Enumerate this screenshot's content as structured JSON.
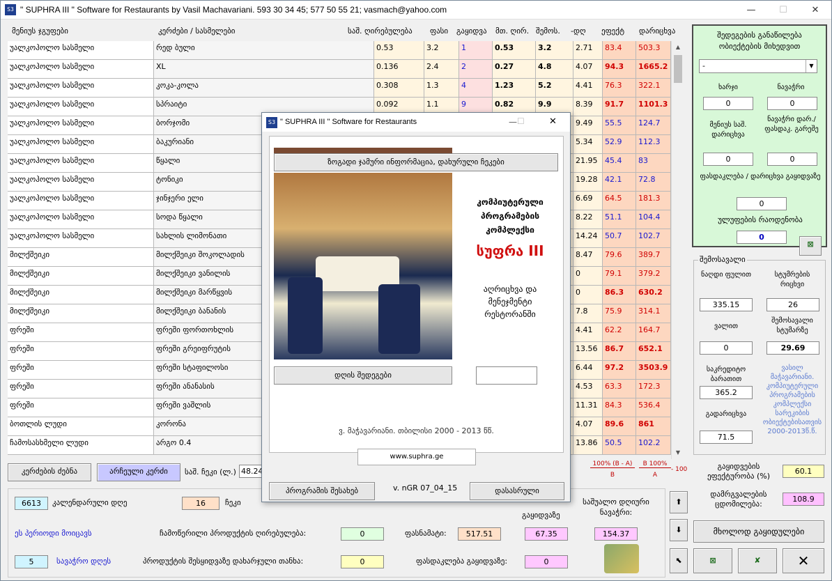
{
  "window": {
    "title": "\" SUPHRA III \" Software for Restaurants by Vasil Machavariani. 593 30 34 45; 577 50 55 21; vasmach@yahoo.com",
    "minimize": "—",
    "maximize": "☐",
    "close": "✕"
  },
  "headers": {
    "group": "მენიუს ჯგუფები",
    "dish": "კერძები / სასმელები",
    "cost": "საშ. ღირებულება",
    "price": "ფასი",
    "sold": "გაყიდვა",
    "perunit": "მთ. ღირ.",
    "income": "შემოს.",
    "diff": "-დღ",
    "eff": "ეფექტ",
    "perc": "დარიცხვა"
  },
  "rows": [
    [
      "უალკოჰოლო სასმელი",
      "რედ ბული",
      "0.53",
      "3.2",
      "1",
      "0.53",
      "3.2",
      "2.71",
      "83.4",
      "503.3",
      0,
      0
    ],
    [
      "უალკოჰოლო სასმელი",
      "XL",
      "0.136",
      "2.4",
      "2",
      "0.27",
      "4.8",
      "4.07",
      "94.3",
      "1665.2",
      1,
      1
    ],
    [
      "უალკოჰოლო სასმელი",
      "კოკა-კოლა",
      "0.308",
      "1.3",
      "4",
      "1.23",
      "5.2",
      "4.41",
      "76.3",
      "322.1",
      0,
      0
    ],
    [
      "უალკოჰოლო სასმელი",
      "სპრაიტი",
      "0.092",
      "1.1",
      "9",
      "0.82",
      "9.9",
      "8.39",
      "91.7",
      "1101.3",
      1,
      1
    ],
    [
      "უალკოჰოლო სასმელი",
      "ბორჯომი",
      "",
      "",
      "",
      "",
      "",
      "9.49",
      "55.5",
      "124.7",
      2,
      2
    ],
    [
      "უალკოჰოლო სასმელი",
      "ბაკურიანი",
      "",
      "",
      "",
      "",
      "",
      "5.34",
      "52.9",
      "112.3",
      2,
      2
    ],
    [
      "უალკოჰოლო სასმელი",
      "წყალი",
      "",
      "",
      "",
      "",
      "",
      "21.95",
      "45.4",
      "83",
      2,
      2
    ],
    [
      "უალკოჰოლო სასმელი",
      "ტონიკი",
      "",
      "",
      "",
      "",
      "",
      "19.28",
      "42.1",
      "72.8",
      2,
      2
    ],
    [
      "უალკოჰოლო სასმელი",
      "ჯინჯერი ელი",
      "",
      "",
      "",
      "",
      "",
      "6.69",
      "64.5",
      "181.3",
      0,
      0
    ],
    [
      "უალკოჰოლო სასმელი",
      "სოდა წყალი",
      "",
      "",
      "",
      "",
      "",
      "8.22",
      "51.1",
      "104.4",
      2,
      2
    ],
    [
      "უალკოჰოლო სასმელი",
      "სახლის ლიმონათი",
      "",
      "",
      "",
      "",
      "",
      "14.24",
      "50.7",
      "102.7",
      2,
      2
    ],
    [
      "მილქშეიკი",
      "მილქშეიკი შოკოლადის",
      "",
      "",
      "",
      "",
      "",
      "8.47",
      "79.6",
      "389.7",
      0,
      0
    ],
    [
      "მილქშეიკი",
      "მილქშეიკი ვანილის",
      "",
      "",
      "",
      "",
      "",
      "0",
      "79.1",
      "379.2",
      0,
      0
    ],
    [
      "მილქშეიკი",
      "მილქშეიკი მარწყვის",
      "",
      "",
      "",
      "",
      "",
      "0",
      "86.3",
      "630.2",
      1,
      1
    ],
    [
      "მილქშეიკი",
      "მილქშეიკი ბანანის",
      "",
      "",
      "",
      "",
      "",
      "7.8",
      "75.9",
      "314.1",
      0,
      0
    ],
    [
      "ფრეში",
      "ფრეში ფორთოხლის",
      "",
      "",
      "",
      "",
      "",
      "4.41",
      "62.2",
      "164.7",
      0,
      0
    ],
    [
      "ფრეში",
      "ფრეში გრეიფრუტის",
      "",
      "",
      "",
      "",
      "",
      "13.56",
      "86.7",
      "652.1",
      1,
      1
    ],
    [
      "ფრეში",
      "ფრეში სტაფილოსი",
      "",
      "",
      "",
      "",
      "",
      "6.44",
      "97.2",
      "3503.9",
      1,
      1
    ],
    [
      "ფრეში",
      "ფრეში ანანასის",
      "",
      "",
      "",
      "",
      "",
      "4.53",
      "63.3",
      "172.3",
      0,
      0
    ],
    [
      "ფრეში",
      "ფრეში ვაშლის",
      "",
      "",
      "",
      "",
      "",
      "11.31",
      "84.3",
      "536.4",
      0,
      0
    ],
    [
      "ბოთლის ლუდი",
      "კორონა",
      "",
      "",
      "",
      "",
      "",
      "4.07",
      "89.6",
      "861",
      1,
      1
    ],
    [
      "ჩამოსასხმელი ლუდი",
      "არგო 0.4",
      "",
      "",
      "",
      "",
      "",
      "13.86",
      "50.5",
      "102.2",
      2,
      2
    ]
  ],
  "right_panel": {
    "title": "შედეგების განაწილება ობიექტების მიხედვით",
    "select_value": "-",
    "expense_label": "ხარჯი",
    "expense": "0",
    "profit_label": "ნავაჭრი",
    "profit": "0",
    "menu_avg_label": "მენიუს საშ. დარიცხვა",
    "menu_avg": "0",
    "profit2_label": "ნავაჭრი დარ./ფასდაკ. გარეშე",
    "profit2": "0",
    "discount_label": "ფასდაკლება / დარიცხვა გაყიდვაზე",
    "discount": "0",
    "packs_label": "ულუფების რაოდენობა",
    "packs": "0"
  },
  "income_panel": {
    "title": "შემოსავალი",
    "cash_label": "ნაღდი ფულით",
    "cash": "335.15",
    "guests_label": "სტუმრების რიცხვი",
    "guests": "26",
    "debt_label": "ვალით",
    "debt": "0",
    "avg_guest_label": "შემოსავალი სტუმარზე",
    "avg_guest": "29.69",
    "card_label": "საკრედიტო ბარათით",
    "card": "365.2",
    "tips_label": "გადარიცხვა",
    "tips": "71.5"
  },
  "author_note": "ვასილ მაჭავარიანი. კომპიუტერული პროგრამების კომპლექსი სარეკიბის ობიექტებისათვის 2000-2013წ.წ.",
  "sales_eff_label": "გაყიდვების ეფექტურობა (%)",
  "sales_eff": "60.1",
  "coef_label": "დამრგვალების ცდომილება:",
  "coef": "108.9",
  "only_sales": "მხოლოდ გაყიდულები",
  "formula": {
    "f1": "100% (B - A)",
    "f1b": "B",
    "f2": "B 100%",
    "f2b": "A",
    "f3": "- 100"
  },
  "bottom": {
    "search_btn": "კერძების ძებნა",
    "selected_btn": "არჩეული კერძი",
    "avg_label": "საშ. ჩეკი (ლ.)",
    "avg_val": "48.24",
    "days_count": "6613",
    "days_label": "კალენდარული დღე",
    "checks": "16",
    "checks_label": "ჩეკი",
    "period_label": "ეს პერიოდი მოიცავს",
    "cost_label": "ჩამოწერილი პროდუქტის ღირებულება:",
    "cost_val": "0",
    "price_label": "ფასნამატი:",
    "price_val": "517.51",
    "pct_val": "67.35",
    "avg_profit_label": "საშუალო დღიური ნავაჭრი:",
    "avg_profit_val": "154.37",
    "trade_days": "5",
    "trade_label": "სავაჭრო დღეს",
    "waste_label": "პროდუქტის შესყიდვაზე დახარჯული თანხა:",
    "waste_val": "0",
    "discount_sale_label": "ფასდაკლება გაყიდვაზე:",
    "discount_sale_val": "0",
    "sales_hdr": "გაყიდვაზე"
  },
  "dialog": {
    "title": "\" SUPHRA III \" Software for Restaurants",
    "info_btn": "ზოგადი ჯამური ინფორმაცია, დახურული ჩეკები",
    "h1": "კომპიუტერული",
    "h2": "პროგრამების",
    "h3": "კომპლექსი",
    "brand": "სუფრა III",
    "sub1": "აღრიცხვა და",
    "sub2": "მენეჯმენტი",
    "sub3": "რესტორანში",
    "day_btn": "დღის შედეგები",
    "copyright": "ვ. მაჭავარიანი. თბილისი 2000 - 2013 წწ.",
    "site": "www.suphra.ge",
    "about_btn": "პროგრამის შესახებ",
    "version": "v. nGR 07_04_15",
    "finish_btn": "დასასრული"
  }
}
